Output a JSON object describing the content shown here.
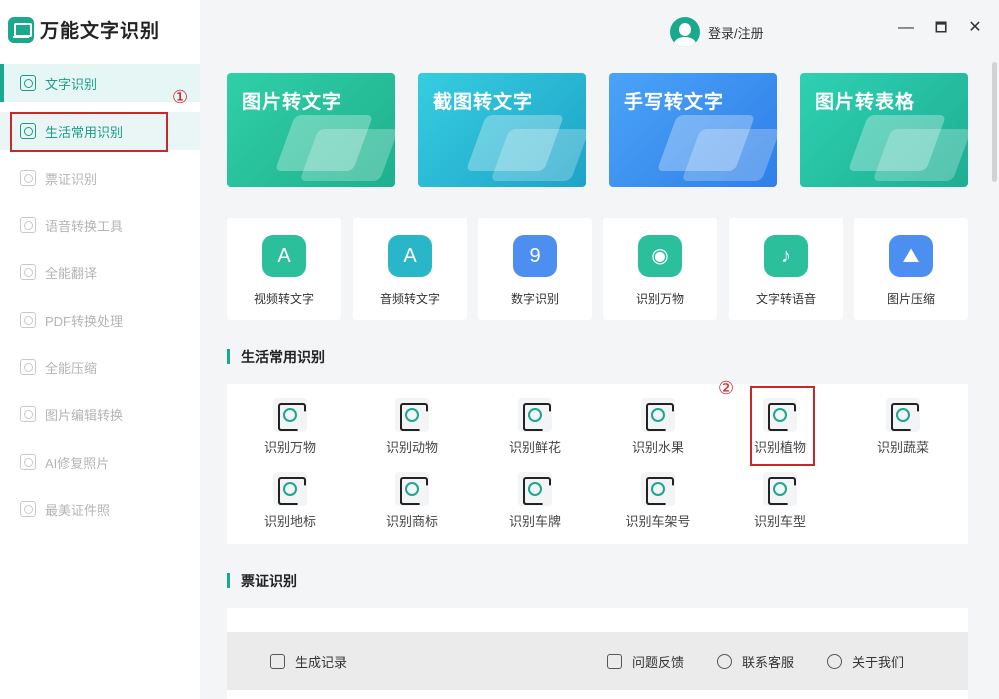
{
  "app": {
    "title": "万能文字识别"
  },
  "sidebar": {
    "items": [
      {
        "label": "文字识别"
      },
      {
        "label": "生活常用识别"
      },
      {
        "label": "票证识别"
      },
      {
        "label": "语音转换工具"
      },
      {
        "label": "全能翻译"
      },
      {
        "label": "PDF转换处理"
      },
      {
        "label": "全能压缩"
      },
      {
        "label": "图片编辑转换"
      },
      {
        "label": "AI修复照片"
      },
      {
        "label": "最美证件照"
      }
    ]
  },
  "annotations": {
    "one": "①",
    "two": "②"
  },
  "header": {
    "login": "登录/注册",
    "minimize": "—",
    "maximize": "🗖",
    "close": "✕"
  },
  "banners": [
    {
      "title": "图片转文字",
      "color": "#26c29c"
    },
    {
      "title": "截图转文字",
      "color": "#27b8d8"
    },
    {
      "title": "手写转文字",
      "color": "#3c8ff0"
    },
    {
      "title": "图片转表格",
      "color": "#25c3a4"
    }
  ],
  "tools": [
    {
      "label": "视频转文字",
      "glyph": "A",
      "color": "#2bbf9c"
    },
    {
      "label": "音频转文字",
      "glyph": "A",
      "color": "#28b6c8"
    },
    {
      "label": "数字识别",
      "glyph": "9",
      "color": "#4d8ff0"
    },
    {
      "label": "识别万物",
      "glyph": "◉",
      "color": "#2bbf9c"
    },
    {
      "label": "文字转语音",
      "glyph": "♪",
      "color": "#2bbf9c"
    },
    {
      "label": "图片压缩",
      "glyph": "⛰",
      "color": "#4d8ff0"
    }
  ],
  "sections": {
    "life": {
      "title": "生活常用识别"
    },
    "ticket": {
      "title": "票证识别"
    }
  },
  "life_items": [
    {
      "label": "识别万物"
    },
    {
      "label": "识别动物"
    },
    {
      "label": "识别鲜花"
    },
    {
      "label": "识别水果"
    },
    {
      "label": "识别植物"
    },
    {
      "label": "识别蔬菜"
    },
    {
      "label": "识别地标"
    },
    {
      "label": "识别商标"
    },
    {
      "label": "识别车牌"
    },
    {
      "label": "识别车架号"
    },
    {
      "label": "识别车型"
    }
  ],
  "footer": {
    "history": "生成记录",
    "feedback": "问题反馈",
    "support": "联系客服",
    "about": "关于我们"
  }
}
